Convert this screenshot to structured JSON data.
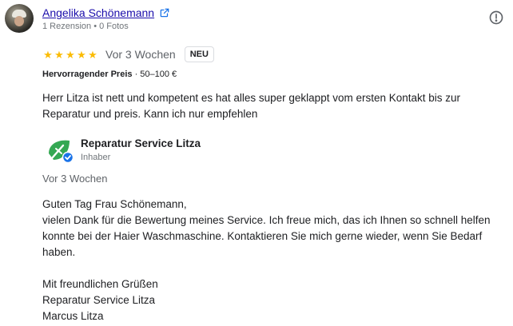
{
  "review": {
    "reviewer_name": "Angelika Schönemann",
    "reviewer_meta": "1 Rezension • 0 Fotos",
    "rating": 5,
    "stars": [
      "★",
      "★",
      "★",
      "★",
      "★"
    ],
    "time_ago": "Vor 3 Wochen",
    "badge": "NEU",
    "price_label": "Hervorragender Preis",
    "price_value": "· 50–100 €",
    "text": "Herr Litza ist nett und kompetent es hat alles super geklappt vom ersten Kontakt bis zur Reparatur und preis. Kann ich nur empfehlen"
  },
  "owner_response": {
    "name": "Reparatur Service Litza",
    "role": "Inhaber",
    "time_ago": "Vor 3 Wochen",
    "paragraph_1": "Guten Tag Frau Schönemann,\nvielen Dank für die Bewertung meines Service. Ich freue mich, das ich Ihnen so schnell helfen konnte bei der Haier Waschmaschine. Kontaktieren Sie mich gerne wieder, wenn Sie Bedarf haben.",
    "paragraph_2": "Mit freundlichen Grüßen\nReparatur Service Litza\nMarcus Litza"
  },
  "icons": {
    "external_link": "external-link-icon",
    "alert": "alert-circle-icon",
    "owner_logo": "leaf-logo-icon",
    "verified": "verified-badge-icon"
  },
  "colors": {
    "link": "#1a0dab",
    "star": "#fbbc04",
    "secondary_text": "#5f6368",
    "logo_green": "#34a853",
    "verified_blue": "#1a73e8"
  }
}
